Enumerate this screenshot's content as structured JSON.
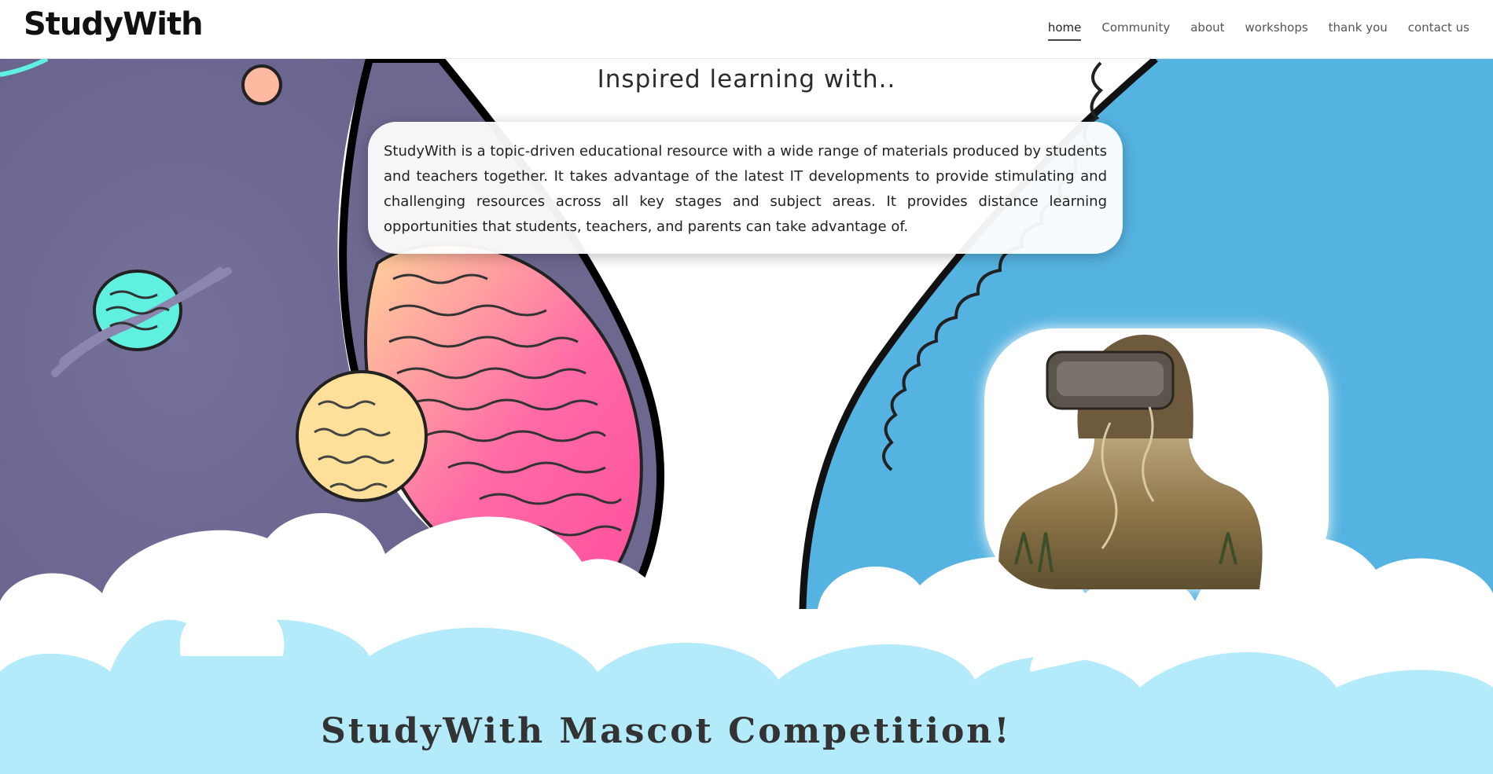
{
  "header": {
    "logo": "StudyWith",
    "nav": [
      {
        "label": "home",
        "active": true
      },
      {
        "label": "Community",
        "active": false
      },
      {
        "label": "about",
        "active": false
      },
      {
        "label": "workshops",
        "active": false
      },
      {
        "label": "thank you",
        "active": false
      },
      {
        "label": "contact us",
        "active": false
      }
    ]
  },
  "hero": {
    "tagline": "Inspired learning with..",
    "intro": "StudyWith is a topic-driven educational resource with a wide range of materials produced by students and teachers together. It takes advantage of the latest IT developments to provide stimulating and challenging resources across all key stages and subject areas. It provides distance learning opportunities that students, teachers, and parents can take advantage of.",
    "image_card": {
      "icon": "vr-headset-person-image"
    }
  },
  "sections": {
    "competition_title": "StudyWith Mascot Competition!"
  },
  "colors": {
    "space_purple": "#6f6a92",
    "sky_blue": "#55b3e1",
    "cloud_light_blue": "#b4ebfb",
    "planet_pink": "#ff5aa2",
    "planet_teal": "#5ff0e0",
    "planet_yellow": "#ffe09a"
  }
}
